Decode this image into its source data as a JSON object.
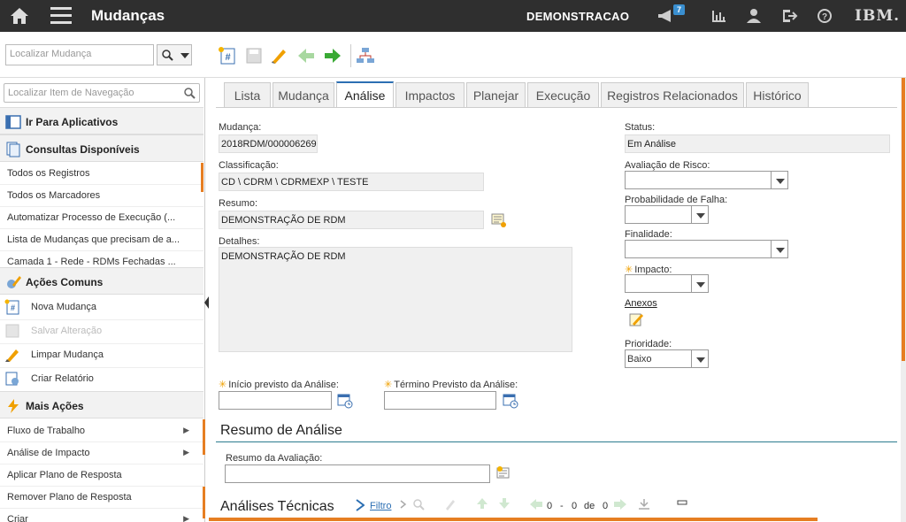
{
  "app": {
    "title": "Mudanças",
    "org": "DEMONSTRACAO",
    "notification_count": "7",
    "brand": "IBM."
  },
  "toolbar": {
    "search_placeholder": "Localizar Mudança"
  },
  "sidebar": {
    "search_placeholder": "Localizar Item de Navegação",
    "go_to_apps": "Ir Para Aplicativos",
    "queries_title": "Consultas Disponíveis",
    "queries": [
      "Todos os Registros",
      "Todos os Marcadores",
      "Automatizar Processo de Execução (...",
      "Lista de Mudanças que precisam de a...",
      "Camada 1 - Rede - RDMs Fechadas ..."
    ],
    "common_title": "Ações Comuns",
    "common_actions": [
      "Nova Mudança",
      "Salvar Alteração",
      "Limpar Mudança",
      "Criar Relatório"
    ],
    "more_title": "Mais Ações",
    "more_actions": [
      "Fluxo de Trabalho",
      "Análise de Impacto",
      "Aplicar Plano de Resposta",
      "Remover Plano de Resposta",
      "Criar"
    ]
  },
  "tabs": [
    "Lista",
    "Mudança",
    "Análise",
    "Impactos",
    "Planejar",
    "Execução",
    "Registros Relacionados",
    "Histórico"
  ],
  "form": {
    "change_label": "Mudança:",
    "change_value": "2018RDM/000006269",
    "class_label": "Classificação:",
    "class_value": "CD \\ CDRM \\ CDRMEXP \\ TESTE",
    "summary_label": "Resumo:",
    "summary_value": "DEMONSTRAÇÃO DE RDM",
    "details_label": "Detalhes:",
    "details_value": "DEMONSTRAÇÃO DE RDM",
    "status_label": "Status:",
    "status_value": "Em Análise",
    "risk_label": "Avaliação de Risco:",
    "failure_label": "Probabilidade de Falha:",
    "purpose_label": "Finalidade:",
    "impact_label": "Impacto:",
    "attachments_label": "Anexos",
    "priority_label": "Prioridade:",
    "priority_value": "Baixo",
    "start_label": "Início previsto da Análise:",
    "end_label": "Término Previsto da Análise:"
  },
  "analysis_summary": {
    "title": "Resumo de Análise",
    "eval_label": "Resumo da Avaliação:"
  },
  "tech": {
    "title": "Análises Técnicas",
    "filter": "Filtro",
    "from": "0",
    "dash": "-",
    "to": "0",
    "of": "de",
    "total": "0"
  }
}
